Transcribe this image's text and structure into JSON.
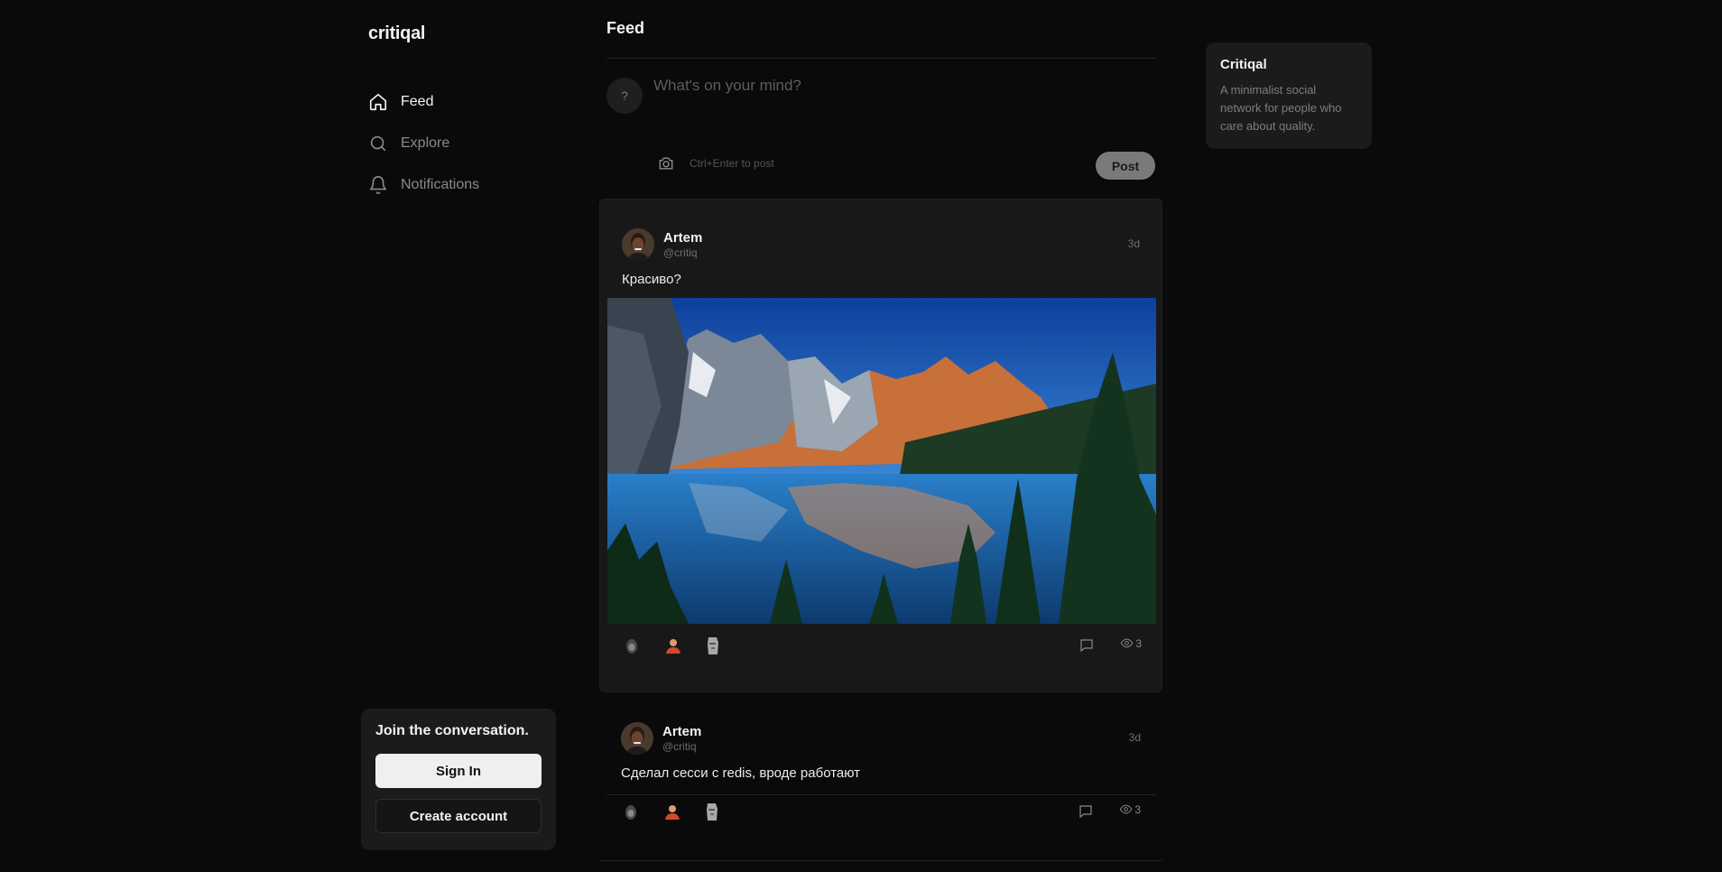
{
  "brand": {
    "logo": "critiqal"
  },
  "nav": [
    {
      "label": "Feed",
      "icon": "home-icon",
      "active": true
    },
    {
      "label": "Explore",
      "icon": "search-icon",
      "active": false
    },
    {
      "label": "Notifications",
      "icon": "bell-icon",
      "active": false
    }
  ],
  "join": {
    "title": "Join the conversation.",
    "sign_in": "Sign In",
    "create": "Create account"
  },
  "feed": {
    "title": "Feed",
    "composer": {
      "avatar": "?",
      "placeholder": "What's on your mind?",
      "hint": "Ctrl+Enter to post",
      "post_button": "Post"
    },
    "posts": [
      {
        "name": "Artem",
        "handle": "@critiq",
        "time": "3d",
        "text": "Красиво?",
        "has_image": true,
        "image_icon": "mountain-lake-photo",
        "reactions": [
          "gorilla-emoji",
          "person-emoji",
          "moai-emoji"
        ],
        "views": "3"
      },
      {
        "name": "Artem",
        "handle": "@critiq",
        "time": "3d",
        "text": "Сделал сесси с redis, вроде работают",
        "has_image": false,
        "reactions": [
          "gorilla-emoji",
          "person-emoji",
          "moai-emoji"
        ],
        "views": "3"
      }
    ]
  },
  "about": {
    "title": "Critiqal",
    "description": "A minimalist social network for people who care about quality."
  },
  "colors": {
    "background": "#0a0a0a",
    "card": "#181818",
    "panel": "#1b1b1b",
    "text": "#f2f2f2",
    "muted": "#7d7d7d",
    "post_button": "#7a7a7a"
  }
}
